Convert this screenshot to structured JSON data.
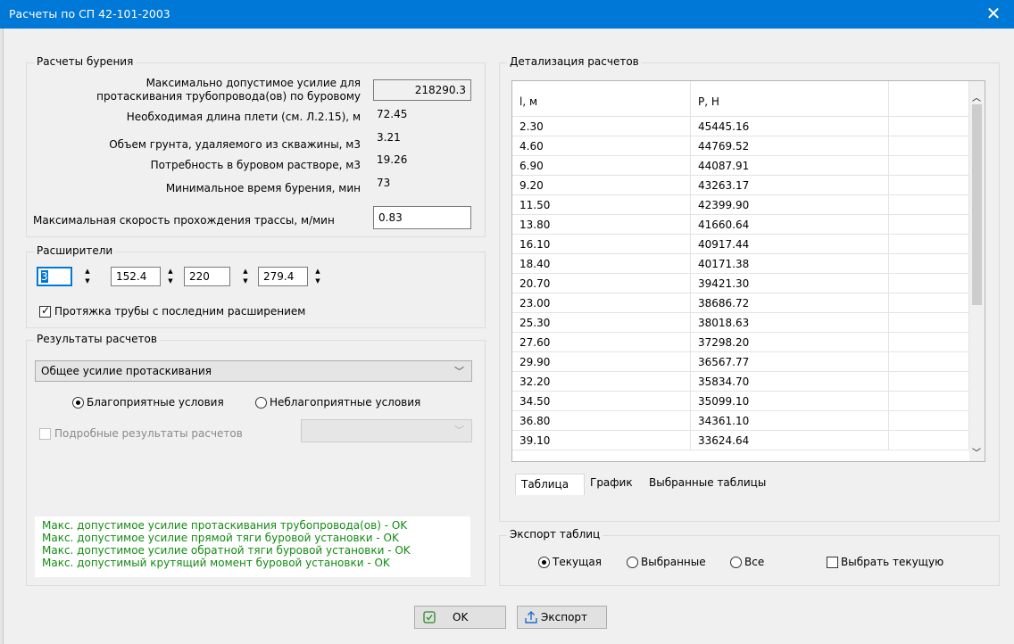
{
  "window": {
    "title": "Расчеты по СП 42-101-2003",
    "close_glyph": "✕"
  },
  "drilling": {
    "legend": "Расчеты бурения",
    "max_force_label_1": "Максимально допустимое усилие для",
    "max_force_label_2": "протаскивания трубопровода(ов) по буровому",
    "max_force_value": "218290.3",
    "string_length_label": "Необходимая длина плети (см. Л.2.15), м",
    "string_length_value": "72.45",
    "soil_volume_label": "Объем грунта, удаляемого из скважины, м3",
    "soil_volume_value": "3.21",
    "mud_need_label": "Потребность в буровом растворе, м3",
    "mud_need_value": "19.26",
    "min_time_label": "Минимальное время бурения, мин",
    "min_time_value": "73",
    "max_speed_label": "Максимальная скорость прохождения трассы, м/мин",
    "max_speed_value": "0.83"
  },
  "reamers": {
    "legend": "Расширители",
    "count": "3",
    "d1": "152.4",
    "d2": "220",
    "d3": "279.4",
    "pull_with_last_label": "Протяжка трубы с последним расширением",
    "pull_with_last_checked": true
  },
  "results": {
    "legend": "Результаты расчетов",
    "select_value": "Общее усилие протаскивания",
    "favorable_label": "Благоприятные условия",
    "unfavorable_label": "Неблагоприятные условия",
    "favorable_selected": true,
    "detailed_label": "Подробные результаты расчетов",
    "status_lines": [
      "Макс. допустимое усилие протаскивания трубопровода(ов)   - OK",
      "Макс. допустимое усилие прямой тяги буровой установки   - OK",
      "Макс. допустимое усилие обратной тяги буровой установки  - OK",
      "Макс. допустимый крутящий момент буровой установки         - OK"
    ],
    "status_color": "#128c12"
  },
  "detail": {
    "legend": "Детализация расчетов",
    "columns": [
      "l, м",
      "P, Н"
    ],
    "rows": [
      [
        "2.30",
        "45445.16"
      ],
      [
        "4.60",
        "44769.52"
      ],
      [
        "6.90",
        "44087.91"
      ],
      [
        "9.20",
        "43263.17"
      ],
      [
        "11.50",
        "42399.90"
      ],
      [
        "13.80",
        "41660.64"
      ],
      [
        "16.10",
        "40917.44"
      ],
      [
        "18.40",
        "40171.38"
      ],
      [
        "20.70",
        "39421.30"
      ],
      [
        "23.00",
        "38686.72"
      ],
      [
        "25.30",
        "38018.63"
      ],
      [
        "27.60",
        "37298.20"
      ],
      [
        "29.90",
        "36567.77"
      ],
      [
        "32.20",
        "35834.70"
      ],
      [
        "34.50",
        "35099.10"
      ],
      [
        "36.80",
        "34361.10"
      ],
      [
        "39.10",
        "33624.64"
      ]
    ],
    "tabs": [
      "Таблица",
      "График",
      "Выбранные таблицы"
    ],
    "active_tab": 0
  },
  "export": {
    "legend": "Экспорт таблиц",
    "current_label": "Текущая",
    "selected_label": "Выбранные",
    "all_label": "Все",
    "choose_current_label": "Выбрать текущую"
  },
  "buttons": {
    "ok_label": "OK",
    "export_label": "Экспорт"
  },
  "colors": {
    "titlebar": "#0078d7",
    "ok_status": "#128c12"
  }
}
